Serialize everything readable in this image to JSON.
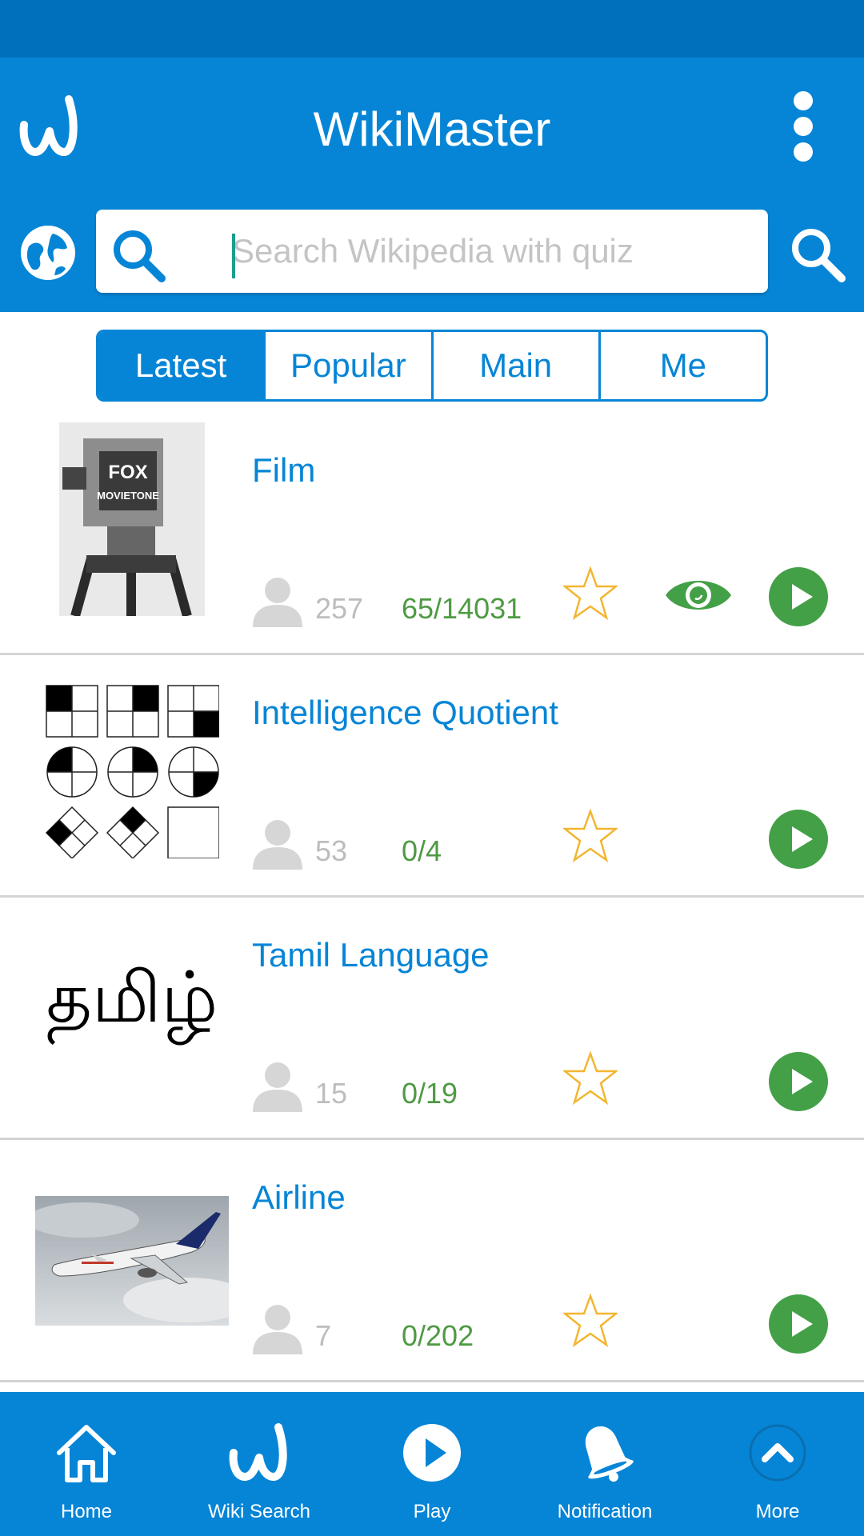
{
  "app": {
    "title": "WikiMaster"
  },
  "search": {
    "placeholder": "Search Wikipedia with quiz"
  },
  "tabs": [
    {
      "label": "Latest",
      "active": true
    },
    {
      "label": "Popular",
      "active": false
    },
    {
      "label": "Main",
      "active": false
    },
    {
      "label": "Me",
      "active": false
    }
  ],
  "articles": [
    {
      "title": "Film",
      "users": "257",
      "score": "65/14031",
      "viewed": true,
      "thumbnail": "fox-movietone-camera"
    },
    {
      "title": "Intelligence Quotient",
      "users": "53",
      "score": "0/4",
      "viewed": false,
      "thumbnail": "iq-pattern-puzzle"
    },
    {
      "title": "Tamil Language",
      "users": "15",
      "score": "0/19",
      "viewed": false,
      "thumbnail": "tamil-script",
      "thumbnail_text": "தமிழ்"
    },
    {
      "title": "Airline",
      "users": "7",
      "score": "0/202",
      "viewed": false,
      "thumbnail": "airplane-photo"
    }
  ],
  "bottom_nav": [
    {
      "label": "Home",
      "icon": "home-icon"
    },
    {
      "label": "Wiki Search",
      "icon": "wiki-logo-icon"
    },
    {
      "label": "Play",
      "icon": "play-icon"
    },
    {
      "label": "Notification",
      "icon": "bell-icon"
    },
    {
      "label": "More",
      "icon": "chevron-up-icon"
    }
  ],
  "colors": {
    "primary": "#0685d6",
    "status_bar": "#0070bd",
    "score_green": "#4e9a43",
    "play_green": "#43a047",
    "star_outline": "#f2b630",
    "muted_gray": "#bdbdbd"
  }
}
